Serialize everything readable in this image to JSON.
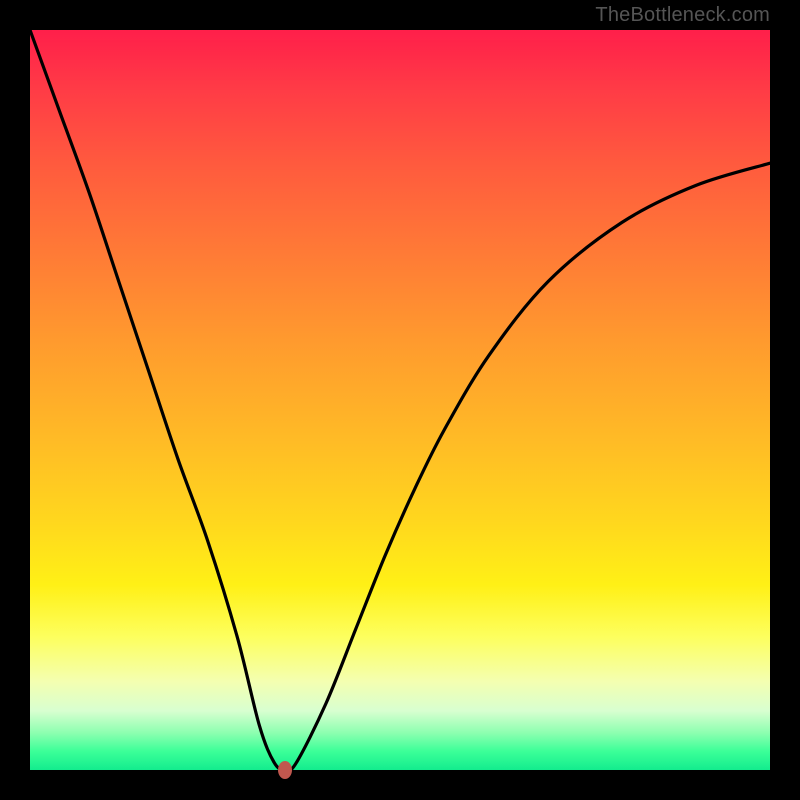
{
  "watermark": "TheBottleneck.com",
  "chart_data": {
    "type": "line",
    "title": "",
    "xlabel": "",
    "ylabel": "",
    "xlim": [
      0,
      100
    ],
    "ylim": [
      0,
      100
    ],
    "grid": false,
    "legend": false,
    "background": {
      "type": "vertical-gradient",
      "stops": [
        {
          "pos": 0.0,
          "color": "#ff1f4a"
        },
        {
          "pos": 0.18,
          "color": "#ff5a3e"
        },
        {
          "pos": 0.42,
          "color": "#ff9a2e"
        },
        {
          "pos": 0.66,
          "color": "#ffd61e"
        },
        {
          "pos": 0.82,
          "color": "#fdff5e"
        },
        {
          "pos": 0.92,
          "color": "#d8ffd0"
        },
        {
          "pos": 1.0,
          "color": "#13ec8e"
        }
      ]
    },
    "series": [
      {
        "name": "bottleneck-curve",
        "color": "#000000",
        "x": [
          0,
          4,
          8,
          12,
          16,
          20,
          24,
          28,
          31,
          33,
          34.5,
          36,
          40,
          44,
          48,
          52,
          56,
          62,
          70,
          80,
          90,
          100
        ],
        "y": [
          100,
          89,
          78,
          66,
          54,
          42,
          31,
          18,
          6,
          1,
          0,
          1,
          9,
          19,
          29,
          38,
          46,
          56,
          66,
          74,
          79,
          82
        ]
      }
    ],
    "markers": [
      {
        "name": "min-point",
        "x": 34.5,
        "y": 0,
        "color": "#c0574e"
      }
    ]
  }
}
